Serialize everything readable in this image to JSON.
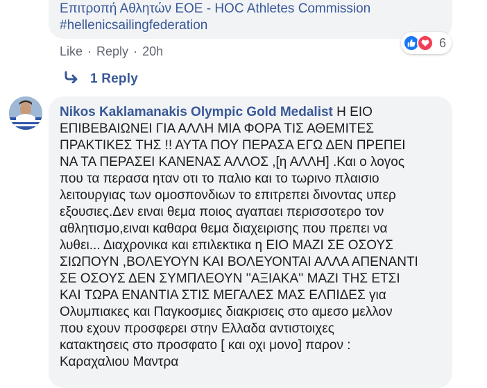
{
  "previous_comment": {
    "lines": [
      "Επιτροπή Αθλητών ΕΟΕ - HOC Athletes Commission",
      "#hellenicsailingfederation"
    ],
    "actions": {
      "like": "Like",
      "reply": "Reply",
      "time": "20h",
      "separator": "·"
    },
    "reactions": {
      "count": "6",
      "types": [
        "like-icon",
        "love-icon"
      ]
    }
  },
  "replies": {
    "label": "1 Reply"
  },
  "comment": {
    "author": "Nikos Kaklamanakis Olympic Gold Medalist",
    "lines": [
      "Η ΕΙΟ",
      "ΕΠΙΒΕΒΑΙΩΝΕΙ ΓΙΑ ΑΛΛΗ ΜΙΑ ΦΟΡΑ ΤΙΣ ΑΘΕΜΙΤΕΣ",
      "ΠΡΑΚΤΙΚΕΣ ΤΗΣ !! ΑΥΤΑ ΠΟΥ ΠΕΡΑΣΑ ΕΓΩ ΔΕΝ ΠΡΕΠΕΙ",
      "ΝΑ ΤΑ ΠΕΡΑΣΕΙ ΚΑΝΕΝΑΣ ΑΛΛΟΣ ,[η ΑΛΛΗ] .Και ο λογος",
      "που τα περασα ηταν οτι το παλιο και το τωρινο πλαισιο",
      "λειτουργιας των ομοσπονδιων το επιτρεπει δινοντας υπερ",
      "εξουσιες.Δεν ειναι θεμα ποιος αγαπαει περισσοτερο τον",
      "αθλητισμο,ειναι καθαρα θεμα διαχειρισης που πρεπει να",
      "λυθει... Διαχρονικα και επιλεκτικα η ΕΙΟ ΜΑΖΙ ΣΕ ΟΣΟΥΣ",
      "ΣΙΩΠΟΥΝ ,ΒΟΛΕΥΟΥΝ ΚΑΙ ΒΟΛΕΥΟΝΤΑΙ ΑΛΛΑ ΑΠΕΝΑΝΤΙ",
      "ΣΕ ΟΣΟΥΣ ΔΕΝ ΣΥΜΠΛΕΟΥΝ ''ΑΞΙΑΚΑ'' ΜΑΖΙ ΤΗΣ ΕΤΣΙ",
      "ΚΑΙ ΤΩΡΑ ΕΝΑΝΤΙΑ ΣΤΙΣ ΜΕΓΑΛΕΣ ΜΑΣ ΕΛΠΙΔΕΣ για",
      "Ολυμπιακες και Παγκοσμιες διακρισεις στο αμεσο μελλον",
      "που εχουν προσφερει στην Ελλαδα αντιστοιχες",
      "κατακτησεις στο προσφατο [ και οχι μονο] παρον :",
      "Καραχαλιου Μαντρα"
    ]
  },
  "colors": {
    "link": "#385898",
    "bubble": "#f2f3f5",
    "meta": "#606770",
    "like": "#1877f2",
    "love": "#f33e58"
  }
}
